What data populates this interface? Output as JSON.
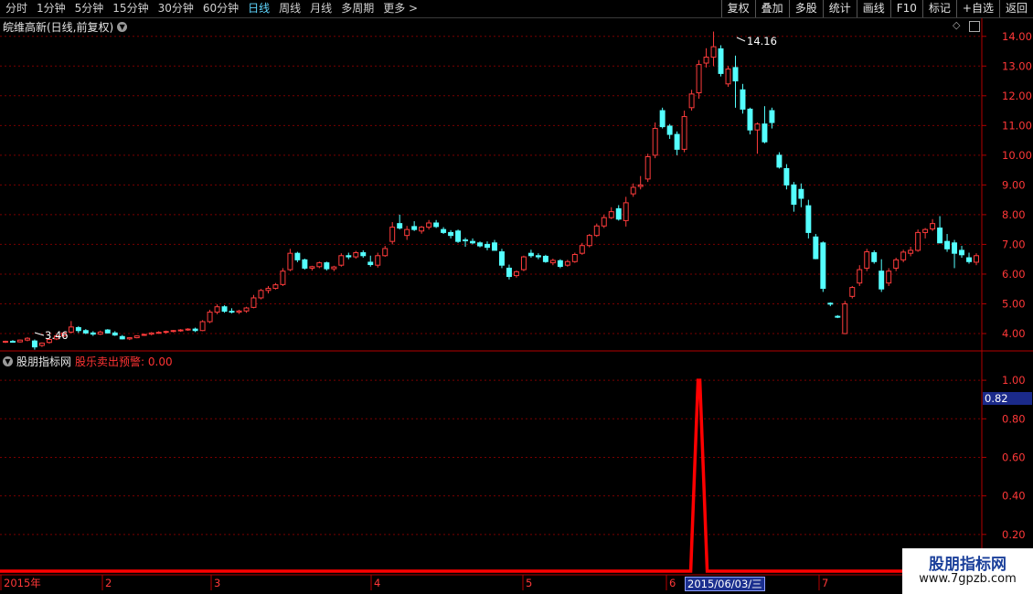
{
  "toolbar": {
    "periods": [
      "分时",
      "1分钟",
      "5分钟",
      "15分钟",
      "30分钟",
      "60分钟",
      "日线",
      "周线",
      "月线",
      "多周期",
      "更多 >"
    ],
    "active_period": "日线",
    "tools": [
      "复权",
      "叠加",
      "多股",
      "统计",
      "画线",
      "F10",
      "标记",
      "+自选",
      "返回"
    ]
  },
  "price_panel": {
    "title": "皖维高新(日线,前复权)",
    "high_label": "14.16",
    "low_label": "3.46",
    "y_ticks": [
      "14.00",
      "13.00",
      "12.00",
      "11.00",
      "10.00",
      "9.00",
      "8.00",
      "7.00",
      "6.00",
      "5.00",
      "4.00"
    ],
    "up_color": "#ff3c3c",
    "down_color": "#54ffff"
  },
  "indicator_panel": {
    "title": "股朋指标网",
    "indicator_label": "股乐卖出预警: 0.00",
    "y_ticks": [
      "1.00",
      "0.80",
      "0.60",
      "0.40",
      "0.20"
    ],
    "current_value": "0.82",
    "line_color": "#ff0000"
  },
  "date_axis": {
    "labels": [
      "2015年",
      "2",
      "3",
      "4",
      "5",
      "6",
      "7"
    ],
    "selected_date": "2015/06/03/三"
  },
  "watermark": {
    "title": "股朋指标网",
    "url": "www.7gpzb.com"
  },
  "chart_data": [
    {
      "type": "candlestick",
      "title": "皖维高新(日线,前复权)",
      "ylim": [
        3.6,
        14.3
      ],
      "y_ticks": [
        4,
        5,
        6,
        7,
        8,
        9,
        10,
        11,
        12,
        13,
        14
      ],
      "ohlc": [
        [
          3.72,
          3.76,
          3.68,
          3.74
        ],
        [
          3.74,
          3.78,
          3.7,
          3.72
        ],
        [
          3.72,
          3.8,
          3.7,
          3.78
        ],
        [
          3.78,
          3.88,
          3.74,
          3.84
        ],
        [
          3.75,
          3.8,
          3.46,
          3.55
        ],
        [
          3.6,
          3.7,
          3.55,
          3.68
        ],
        [
          3.7,
          3.82,
          3.66,
          3.8
        ],
        [
          3.82,
          3.95,
          3.78,
          3.92
        ],
        [
          3.92,
          4.05,
          3.88,
          4.02
        ],
        [
          4.05,
          4.42,
          4.0,
          4.22
        ],
        [
          4.2,
          4.25,
          4.02,
          4.1
        ],
        [
          4.1,
          4.15,
          3.98,
          4.02
        ],
        [
          4.02,
          4.08,
          3.92,
          3.98
        ],
        [
          3.98,
          4.1,
          3.95,
          4.05
        ],
        [
          4.12,
          4.15,
          4.0,
          4.02
        ],
        [
          4.02,
          4.08,
          3.92,
          3.95
        ],
        [
          3.9,
          3.95,
          3.8,
          3.82
        ],
        [
          3.82,
          3.88,
          3.78,
          3.86
        ],
        [
          3.86,
          3.94,
          3.84,
          3.92
        ],
        [
          3.95,
          4.0,
          3.92,
          3.97
        ],
        [
          3.98,
          4.05,
          3.94,
          4.02
        ],
        [
          4.02,
          4.08,
          3.99,
          4.04
        ],
        [
          4.04,
          4.1,
          4.0,
          4.07
        ],
        [
          4.07,
          4.12,
          4.04,
          4.1
        ],
        [
          4.1,
          4.15,
          4.06,
          4.12
        ],
        [
          4.12,
          4.18,
          4.09,
          4.15
        ],
        [
          4.15,
          4.2,
          4.05,
          4.1
        ],
        [
          4.1,
          4.45,
          4.08,
          4.4
        ],
        [
          4.4,
          4.8,
          4.35,
          4.72
        ],
        [
          4.72,
          4.98,
          4.65,
          4.9
        ],
        [
          4.9,
          4.95,
          4.7,
          4.75
        ],
        [
          4.75,
          4.85,
          4.68,
          4.72
        ],
        [
          4.72,
          4.8,
          4.66,
          4.76
        ],
        [
          4.76,
          4.9,
          4.7,
          4.86
        ],
        [
          4.88,
          5.3,
          4.85,
          5.2
        ],
        [
          5.2,
          5.5,
          5.15,
          5.45
        ],
        [
          5.45,
          5.6,
          5.35,
          5.52
        ],
        [
          5.52,
          5.7,
          5.48,
          5.64
        ],
        [
          5.65,
          6.2,
          5.6,
          6.1
        ],
        [
          6.15,
          6.85,
          6.1,
          6.7
        ],
        [
          6.7,
          6.75,
          6.4,
          6.48
        ],
        [
          6.48,
          6.52,
          6.15,
          6.2
        ],
        [
          6.2,
          6.28,
          6.12,
          6.25
        ],
        [
          6.25,
          6.42,
          6.2,
          6.38
        ],
        [
          6.38,
          6.42,
          6.12,
          6.18
        ],
        [
          6.18,
          6.28,
          6.1,
          6.24
        ],
        [
          6.3,
          6.7,
          6.25,
          6.62
        ],
        [
          6.62,
          6.72,
          6.5,
          6.58
        ],
        [
          6.58,
          6.78,
          6.52,
          6.72
        ],
        [
          6.72,
          6.8,
          6.55,
          6.62
        ],
        [
          6.4,
          6.62,
          6.25,
          6.32
        ],
        [
          6.3,
          6.72,
          6.22,
          6.62
        ],
        [
          6.62,
          6.95,
          6.58,
          6.86
        ],
        [
          7.1,
          7.75,
          7.0,
          7.58
        ],
        [
          7.7,
          8.0,
          7.5,
          7.55
        ],
        [
          7.3,
          7.62,
          7.15,
          7.5
        ],
        [
          7.6,
          7.78,
          7.45,
          7.5
        ],
        [
          7.45,
          7.62,
          7.36,
          7.58
        ],
        [
          7.58,
          7.82,
          7.5,
          7.72
        ],
        [
          7.72,
          7.82,
          7.55,
          7.6
        ],
        [
          7.5,
          7.58,
          7.35,
          7.4
        ],
        [
          7.4,
          7.48,
          7.2,
          7.3
        ],
        [
          7.45,
          7.5,
          7.05,
          7.1
        ],
        [
          7.15,
          7.22,
          6.92,
          7.12
        ],
        [
          7.1,
          7.2,
          7.0,
          7.05
        ],
        [
          7.05,
          7.1,
          6.9,
          6.95
        ],
        [
          7.0,
          7.1,
          6.8,
          6.9
        ],
        [
          7.05,
          7.15,
          6.8,
          6.8
        ],
        [
          6.75,
          6.85,
          6.2,
          6.3
        ],
        [
          6.2,
          6.32,
          5.82,
          5.92
        ],
        [
          5.95,
          6.12,
          5.88,
          6.08
        ],
        [
          6.15,
          6.62,
          6.1,
          6.58
        ],
        [
          6.7,
          6.82,
          6.55,
          6.62
        ],
        [
          6.62,
          6.7,
          6.5,
          6.58
        ],
        [
          6.6,
          6.65,
          6.38,
          6.42
        ],
        [
          6.38,
          6.52,
          6.3,
          6.46
        ],
        [
          6.45,
          6.5,
          6.2,
          6.26
        ],
        [
          6.3,
          6.48,
          6.25,
          6.42
        ],
        [
          6.42,
          6.72,
          6.38,
          6.66
        ],
        [
          6.7,
          7.05,
          6.65,
          6.96
        ],
        [
          6.96,
          7.35,
          6.9,
          7.3
        ],
        [
          7.3,
          7.7,
          7.25,
          7.62
        ],
        [
          7.62,
          8.0,
          7.55,
          7.9
        ],
        [
          7.9,
          8.25,
          7.85,
          8.1
        ],
        [
          8.2,
          8.32,
          7.8,
          7.85
        ],
        [
          7.8,
          8.6,
          7.6,
          8.4
        ],
        [
          8.7,
          9.05,
          8.6,
          8.92
        ],
        [
          8.95,
          9.3,
          8.85,
          9.0
        ],
        [
          9.2,
          10.05,
          9.1,
          9.95
        ],
        [
          10.0,
          11.1,
          9.9,
          10.9
        ],
        [
          11.5,
          11.6,
          10.9,
          10.96
        ],
        [
          10.98,
          11.05,
          10.55,
          10.7
        ],
        [
          10.7,
          10.8,
          10.0,
          10.2
        ],
        [
          10.2,
          11.5,
          10.1,
          11.3
        ],
        [
          11.6,
          12.2,
          11.5,
          12.06
        ],
        [
          12.1,
          13.2,
          11.9,
          13.05
        ],
        [
          13.1,
          13.6,
          12.95,
          13.3
        ],
        [
          13.3,
          14.16,
          13.0,
          13.65
        ],
        [
          13.58,
          13.7,
          12.65,
          12.75
        ],
        [
          12.4,
          13.0,
          12.3,
          12.9
        ],
        [
          12.95,
          13.35,
          11.6,
          12.5
        ],
        [
          12.2,
          12.4,
          11.4,
          11.55
        ],
        [
          11.55,
          11.6,
          10.7,
          10.85
        ],
        [
          10.85,
          11.1,
          10.05,
          11.05
        ],
        [
          11.05,
          11.65,
          10.4,
          10.45
        ],
        [
          11.5,
          11.6,
          10.9,
          11.1
        ],
        [
          10.0,
          10.1,
          9.55,
          9.6
        ],
        [
          9.55,
          9.7,
          8.85,
          9.0
        ],
        [
          9.0,
          9.1,
          8.1,
          8.35
        ],
        [
          8.85,
          9.05,
          8.25,
          8.55
        ],
        [
          8.3,
          8.5,
          7.2,
          7.4
        ],
        [
          7.25,
          7.35,
          6.5,
          6.52
        ],
        [
          7.05,
          7.1,
          5.4,
          5.52
        ],
        [
          5.02,
          5.05,
          4.92,
          5.0
        ],
        [
          4.58,
          4.62,
          4.52,
          4.55
        ],
        [
          4.0,
          5.1,
          3.98,
          5.0
        ],
        [
          5.25,
          5.6,
          5.18,
          5.55
        ],
        [
          5.7,
          6.3,
          5.6,
          6.15
        ],
        [
          6.2,
          6.85,
          6.1,
          6.75
        ],
        [
          6.72,
          6.8,
          6.35,
          6.42
        ],
        [
          6.1,
          6.5,
          5.4,
          5.5
        ],
        [
          5.7,
          6.2,
          5.6,
          6.1
        ],
        [
          6.2,
          6.55,
          6.1,
          6.48
        ],
        [
          6.48,
          6.82,
          6.4,
          6.74
        ],
        [
          6.7,
          6.92,
          6.6,
          6.8
        ],
        [
          6.8,
          7.5,
          6.75,
          7.4
        ],
        [
          7.4,
          7.55,
          7.2,
          7.5
        ],
        [
          7.52,
          7.85,
          7.45,
          7.7
        ],
        [
          7.55,
          7.95,
          7.1,
          7.05
        ],
        [
          7.1,
          7.35,
          6.75,
          6.85
        ],
        [
          7.05,
          7.15,
          6.2,
          6.7
        ],
        [
          6.8,
          6.95,
          6.55,
          6.65
        ],
        [
          6.55,
          6.72,
          6.35,
          6.42
        ],
        [
          6.4,
          6.7,
          6.3,
          6.62
        ]
      ],
      "high_marker": "14.16",
      "low_marker": "3.46"
    },
    {
      "type": "line",
      "title": "股乐卖出预警",
      "ylim": [
        0,
        1.1
      ],
      "y_ticks": [
        0.2,
        0.4,
        0.6,
        0.8,
        1.0
      ],
      "series": [
        {
          "name": "股乐卖出预警",
          "peak_index": 95,
          "peak_value": 1.0,
          "baseline": 0.0
        }
      ]
    }
  ]
}
